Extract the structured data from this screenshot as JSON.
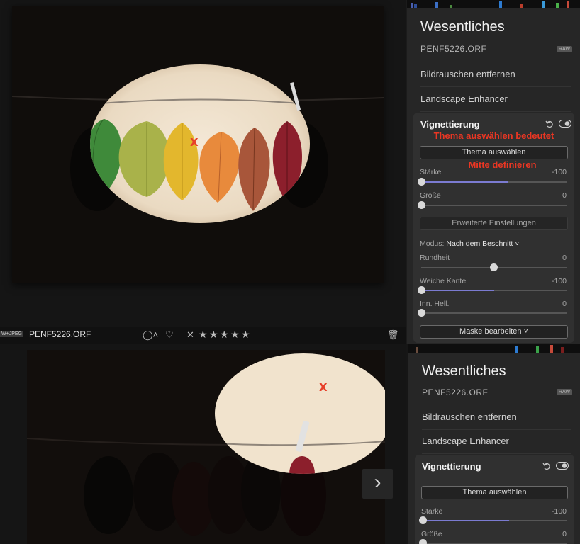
{
  "top": {
    "sidebar": {
      "title": "Wesentliches",
      "filename": "PENF5226.ORF",
      "raw_badge": "RAW",
      "items": [
        "Bildrauschen entfernen",
        "Landscape Enhancer"
      ],
      "vignette": {
        "title": "Vignettierung",
        "annotation_1": "Thema auswählen bedeutet",
        "select_subject_label": "Thema auswählen",
        "annotation_2": "Mitte definieren",
        "sliders": [
          {
            "label": "Stärke",
            "value": "-100",
            "position": 0.0
          },
          {
            "label": "Größe",
            "value": "0",
            "position": 0.0
          }
        ],
        "advanced_label": "Erweiterte Einstellungen",
        "mode_label": "Modus:",
        "mode_value": "Nach dem Beschnitt",
        "sliders2": [
          {
            "label": "Rundheit",
            "value": "0",
            "position": 0.5
          },
          {
            "label": "Weiche Kante",
            "value": "-100",
            "position": 0.0
          },
          {
            "label": "Inn. Hell.",
            "value": "0",
            "position": 0.0
          }
        ],
        "mask_label": "Maske bearbeiten"
      }
    },
    "bottombar": {
      "badge": "W+JPEG",
      "filename": "PENF5226.ORF",
      "rating_stars": 5
    },
    "marker": "X"
  },
  "bottom": {
    "sidebar": {
      "title": "Wesentliches",
      "filename": "PENF5226.ORF",
      "raw_badge": "RAW",
      "items": [
        "Bildrauschen entfernen",
        "Landscape Enhancer"
      ],
      "vignette": {
        "title": "Vignettierung",
        "select_subject_label": "Thema auswählen",
        "sliders": [
          {
            "label": "Stärke",
            "value": "-100",
            "position": 0.0
          },
          {
            "label": "Größe",
            "value": "0",
            "position": 0.0
          }
        ]
      }
    },
    "marker": "X"
  },
  "colors": {
    "accent_slider": "#7b7bd1",
    "annotation_red": "#ea3623"
  }
}
